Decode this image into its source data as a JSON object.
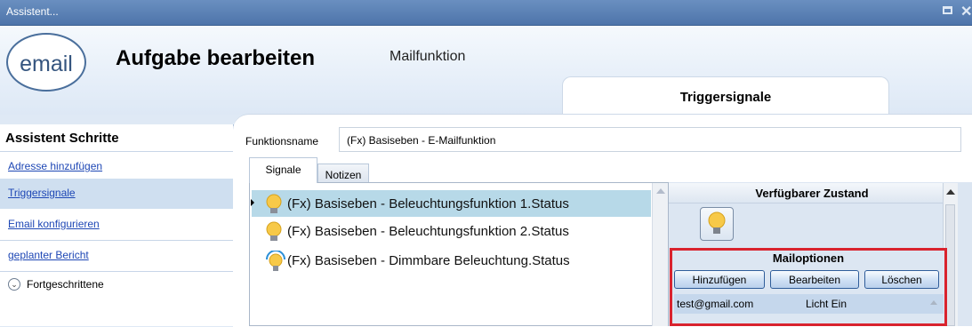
{
  "window": {
    "title": "Assistent..."
  },
  "header": {
    "logo_text": "email",
    "title": "Aufgabe bearbeiten",
    "subtitle": "Mailfunktion",
    "active_tab": "Triggersignale"
  },
  "sidebar": {
    "heading": "Assistent Schritte",
    "items": [
      {
        "label": "Adresse hinzufügen"
      },
      {
        "label": "Triggersignale"
      },
      {
        "label": "Email konfigurieren"
      },
      {
        "label": "geplanter Bericht"
      }
    ],
    "advanced_label": "Fortgeschrittene"
  },
  "main": {
    "function_name_label": "Funktionsname",
    "function_name_value": "(Fx) Basiseben - E-Mailfunktion",
    "tabs": [
      {
        "label": "Signale"
      },
      {
        "label": "Notizen"
      }
    ],
    "signals": [
      {
        "text": "(Fx) Basiseben - Beleuchtungsfunktion 1.Status",
        "icon": "light-bulb-icon"
      },
      {
        "text": "(Fx) Basiseben - Beleuchtungsfunktion 2.Status",
        "icon": "light-bulb-icon"
      },
      {
        "text": "(Fx) Basiseben - Dimmbare Beleuchtung.Status",
        "icon": "dimmable-bulb-icon"
      }
    ]
  },
  "right_panel": {
    "available_state_title": "Verfügbarer Zustand",
    "mail_options": {
      "title": "Mailoptionen",
      "buttons": {
        "add": "Hinzufügen",
        "edit": "Bearbeiten",
        "delete": "Löschen"
      },
      "rows": [
        {
          "email": "test@gmail.com",
          "state": "Licht Ein"
        }
      ]
    }
  }
}
